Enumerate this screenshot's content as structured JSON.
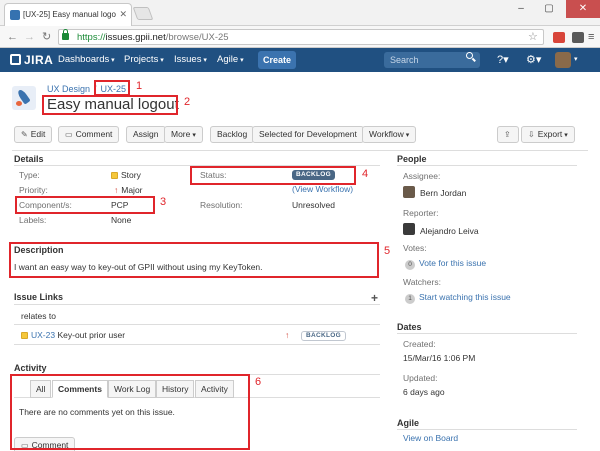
{
  "browser": {
    "tab_title": "[UX-25] Easy manual logo",
    "url_scheme": "https://",
    "url_host": "issues.gpii.net",
    "url_path": "/browse/UX-25"
  },
  "header": {
    "logo": "JIRA",
    "nav": [
      "Dashboards",
      "Projects",
      "Issues",
      "Agile"
    ],
    "create_label": "Create",
    "search_placeholder": "Search"
  },
  "issue": {
    "project": "UX Design",
    "breadcrumb_sep": "/",
    "key": "UX-25",
    "title": "Easy manual logout"
  },
  "toolbar": {
    "edit": "Edit",
    "comment": "Comment",
    "assign": "Assign",
    "more": "More",
    "backlog": "Backlog",
    "selected": "Selected for Development",
    "workflow": "Workflow",
    "export": "Export"
  },
  "details": {
    "heading": "Details",
    "type_label": "Type:",
    "type_value": "Story",
    "priority_label": "Priority:",
    "priority_value": "Major",
    "components_label": "Component/s:",
    "components_value": "PCP",
    "labels_label": "Labels:",
    "labels_value": "None",
    "status_label": "Status:",
    "status_value": "BACKLOG",
    "view_workflow": "(View Workflow)",
    "resolution_label": "Resolution:",
    "resolution_value": "Unresolved"
  },
  "description": {
    "heading": "Description",
    "text": "I want an easy way to key-out of GPII without using my KeyToken."
  },
  "issue_links": {
    "heading": "Issue Links",
    "relation": "relates to",
    "linked_key": "UX-23",
    "linked_summary": "Key-out prior user",
    "linked_status": "BACKLOG"
  },
  "activity": {
    "heading": "Activity",
    "tabs": [
      "All",
      "Comments",
      "Work Log",
      "History",
      "Activity"
    ],
    "empty_text": "There are no comments yet on this issue.",
    "comment_button": "Comment"
  },
  "people": {
    "heading": "People",
    "assignee_label": "Assignee:",
    "assignee": "Bern Jordan",
    "reporter_label": "Reporter:",
    "reporter": "Alejandro Leiva",
    "votes_label": "Votes:",
    "votes_count": "0",
    "vote_link": "Vote for this issue",
    "watchers_label": "Watchers:",
    "watchers_count": "1",
    "watch_link": "Start watching this issue"
  },
  "dates": {
    "heading": "Dates",
    "created_label": "Created:",
    "created": "15/Mar/16 1:06 PM",
    "updated_label": "Updated:",
    "updated": "6 days ago"
  },
  "agile": {
    "heading": "Agile",
    "view_board": "View on Board"
  },
  "annotations": [
    "1",
    "2",
    "3",
    "4",
    "5",
    "6"
  ],
  "colors": {
    "header_bg": "#205081",
    "link": "#3b73af",
    "annotation": "#e0252b",
    "lozenge": "#4a6785"
  }
}
